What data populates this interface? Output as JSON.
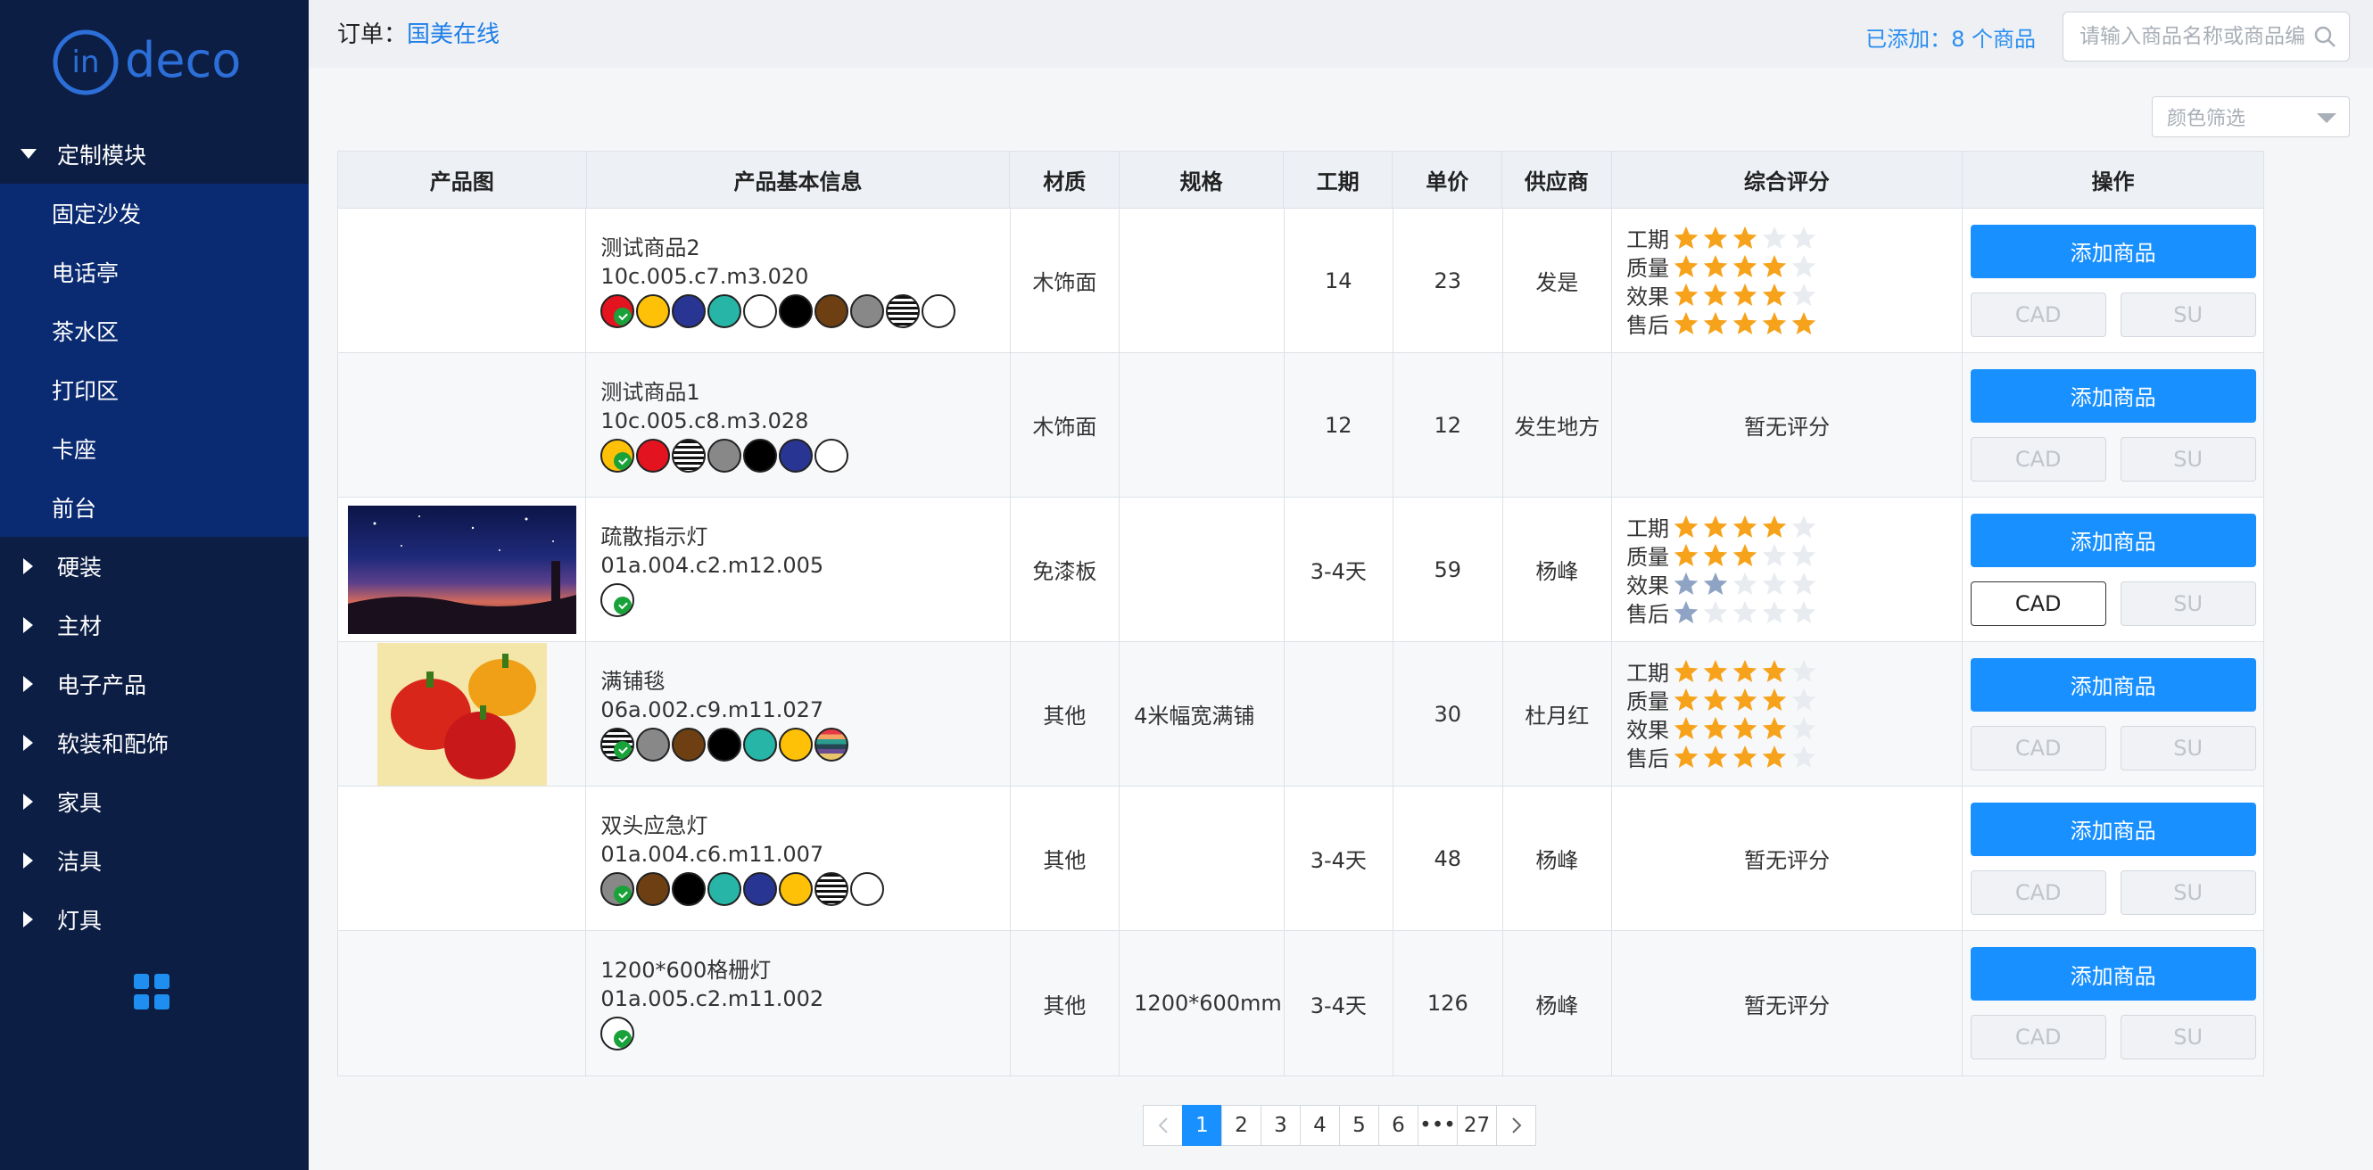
{
  "app": {
    "logo_text": "in deco"
  },
  "sidebar": {
    "groups": [
      {
        "label": "定制模块",
        "expanded": true,
        "items": [
          "固定沙发",
          "电话亭",
          "茶水区",
          "打印区",
          "卡座",
          "前台"
        ]
      },
      {
        "label": "硬装",
        "expanded": false
      },
      {
        "label": "主材",
        "expanded": false
      },
      {
        "label": "电子产品",
        "expanded": false
      },
      {
        "label": "软装和配饰",
        "expanded": false
      },
      {
        "label": "家具",
        "expanded": false
      },
      {
        "label": "洁具",
        "expanded": false
      },
      {
        "label": "灯具",
        "expanded": false
      }
    ]
  },
  "header": {
    "order_prefix": "订单：",
    "order_name": "国美在线",
    "added_text": "已添加：8 个商品",
    "search_placeholder": "请输入商品名称或商品编号"
  },
  "filter": {
    "color_placeholder": "颜色筛选"
  },
  "table": {
    "columns": [
      "产品图",
      "产品基本信息",
      "材质",
      "规格",
      "工期",
      "单价",
      "供应商",
      "综合评分",
      "操作"
    ],
    "rating_labels": [
      "工期",
      "质量",
      "效果",
      "售后"
    ],
    "no_rating": "暂无评分",
    "btn_add": "添加商品",
    "btn_cad": "CAD",
    "btn_su": "SU",
    "rows": [
      {
        "image": "",
        "name": "测试商品2",
        "code": "10c.005.c7.m3.020",
        "swatches": [
          "#e3141f",
          "#ffc107",
          "#283593",
          "#26b5a6",
          "#ffffff",
          "#000000",
          "#6d3f12",
          "#888888",
          "striped",
          "#ffffff"
        ],
        "material": "木饰面",
        "spec": "",
        "period": "14",
        "price": "23",
        "supplier": "发是",
        "ratings": [
          3,
          4,
          4,
          5
        ],
        "rating_color": "orange",
        "cad_enabled": false
      },
      {
        "image": "",
        "name": "测试商品1",
        "code": "10c.005.c8.m3.028",
        "swatches": [
          "#ffc107",
          "#e3141f",
          "striped",
          "#888888",
          "#000000",
          "#283593",
          "#ffffff"
        ],
        "material": "木饰面",
        "spec": "",
        "period": "12",
        "price": "12",
        "supplier": "发生地方",
        "ratings": null,
        "cad_enabled": false
      },
      {
        "image": "night-sky",
        "name": "疏散指示灯",
        "code": "01a.004.c2.m12.005",
        "swatches": [
          "#ffffff"
        ],
        "material": "免漆板",
        "spec": "",
        "period": "3-4天",
        "price": "59",
        "supplier": "杨峰",
        "ratings": [
          4,
          3,
          2,
          1
        ],
        "rating_color": "mixed",
        "cad_enabled": true
      },
      {
        "image": "peppers",
        "name": "满铺毯",
        "code": "06a.002.c9.m11.027",
        "swatches": [
          "striped",
          "#888888",
          "#6d3f12",
          "#000000",
          "#26b5a6",
          "#ffc107",
          "rainbow"
        ],
        "material": "其他",
        "spec": "4米幅宽满铺",
        "period": "",
        "price": "30",
        "supplier": "杜月红",
        "ratings": [
          4,
          4,
          4,
          4
        ],
        "rating_color": "orange",
        "cad_enabled": false
      },
      {
        "image": "",
        "name": "双头应急灯",
        "code": "01a.004.c6.m11.007",
        "swatches": [
          "#888888",
          "#6d3f12",
          "#000000",
          "#26b5a6",
          "#283593",
          "#ffc107",
          "striped",
          "#ffffff"
        ],
        "material": "其他",
        "spec": "",
        "period": "3-4天",
        "price": "48",
        "supplier": "杨峰",
        "ratings": null,
        "cad_enabled": false
      },
      {
        "image": "",
        "name": "1200*600格栅灯",
        "code": "01a.005.c2.m11.002",
        "swatches": [
          "#ffffff"
        ],
        "material": "其他",
        "spec": "1200*600mm",
        "period": "3-4天",
        "price": "126",
        "supplier": "杨峰",
        "ratings": null,
        "cad_enabled": false
      }
    ]
  },
  "pagination": {
    "pages": [
      "1",
      "2",
      "3",
      "4",
      "5",
      "6",
      "•••",
      "27"
    ],
    "current": "1"
  },
  "colors": {
    "sidebar_bg": "#0d1e45",
    "submenu_bg": "#0a2a72",
    "accent": "#1890ff",
    "star": "#f7a21b",
    "star_blue": "#8fa4c4",
    "star_empty": "#e8ebef"
  }
}
